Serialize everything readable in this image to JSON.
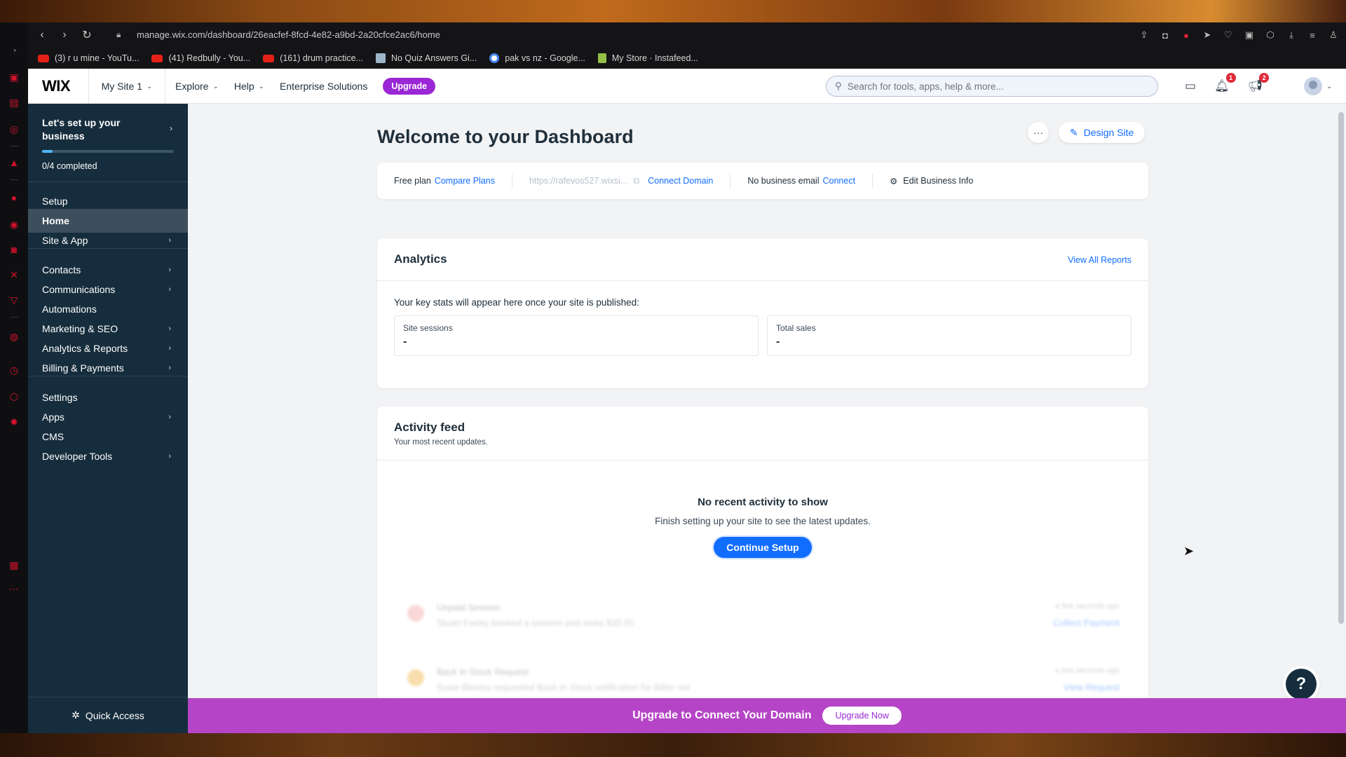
{
  "browser": {
    "url": "manage.wix.com/dashboard/26eacfef-8fcd-4e82-a9bd-2a20cfce2ac6/home",
    "bookmarks": [
      {
        "label": "(3) r u mine - YouTu...",
        "icon": "youtube-icon"
      },
      {
        "label": "(41) Redbully - You...",
        "icon": "youtube-icon"
      },
      {
        "label": "(161) drum practice...",
        "icon": "youtube-icon"
      },
      {
        "label": "No Quiz Answers Gi...",
        "icon": "quiz-icon"
      },
      {
        "label": "pak vs nz - Google...",
        "icon": "google-icon"
      },
      {
        "label": "My Store · Instafeed...",
        "icon": "shopify-icon"
      }
    ]
  },
  "topbar": {
    "logo": "WIX",
    "site_name": "My Site 1",
    "nav": [
      "Explore",
      "Help",
      "Enterprise Solutions"
    ],
    "upgrade": "Upgrade",
    "search_placeholder": "Search for tools, apps, help & more...",
    "notifications_badge": "1",
    "announcements_badge": "2"
  },
  "sidebar": {
    "setup_title": "Let's set up your business",
    "setup_progress": "0/4 completed",
    "setup_progress_fraction": 0.08,
    "items": [
      {
        "label": "Setup",
        "arrow": false
      },
      {
        "label": "Home",
        "arrow": false,
        "active": true
      },
      {
        "label": "Site & App",
        "arrow": true
      },
      {
        "label": "Contacts",
        "arrow": true
      },
      {
        "label": "Communications",
        "arrow": true
      },
      {
        "label": "Automations",
        "arrow": false
      },
      {
        "label": "Marketing & SEO",
        "arrow": true
      },
      {
        "label": "Analytics & Reports",
        "arrow": true
      },
      {
        "label": "Billing & Payments",
        "arrow": true
      },
      {
        "label": "Settings",
        "arrow": false
      },
      {
        "label": "Apps",
        "arrow": true
      },
      {
        "label": "CMS",
        "arrow": false
      },
      {
        "label": "Developer Tools",
        "arrow": true
      }
    ],
    "quick_access": "Quick Access"
  },
  "main": {
    "title": "Welcome to your Dashboard",
    "design_site": "Design Site",
    "info": {
      "plan": "Free plan",
      "compare_plans": "Compare Plans",
      "site_url": "https://rafevos527.wixsi...",
      "connect_domain": "Connect Domain",
      "no_email": "No business email",
      "connect": "Connect",
      "edit_info": "Edit Business Info"
    },
    "analytics": {
      "title": "Analytics",
      "view_all": "View All Reports",
      "note": "Your key stats will appear here once your site is published:",
      "stats": [
        {
          "label": "Site sessions",
          "value": "-"
        },
        {
          "label": "Total sales",
          "value": "-"
        }
      ]
    },
    "activity": {
      "title": "Activity feed",
      "subtitle": "Your most recent updates.",
      "empty_title": "No recent activity to show",
      "empty_sub": "Finish setting up your site to see the latest updates.",
      "continue": "Continue Setup",
      "ghost_rows": [
        {
          "title": "Unpaid Session",
          "sub": "Stuart Farley booked a session and owes $35.50",
          "time": "a few seconds ago",
          "link": "Collect Payment",
          "color": "#f6b9b9"
        },
        {
          "title": "Back in Stock Request",
          "sub": "Susie Blevins requested Back in Stock notification for Bitter set",
          "time": "a few seconds ago",
          "link": "View Request",
          "color": "#f2c46a"
        }
      ]
    }
  },
  "banner": {
    "message": "Upgrade to Connect Your Domain",
    "button": "Upgrade Now"
  },
  "colors": {
    "brand_blue": "#116dff",
    "sidebar_bg": "#162d3d",
    "upgrade_purple": "#9a27d5",
    "banner_purple": "#b545c6"
  }
}
